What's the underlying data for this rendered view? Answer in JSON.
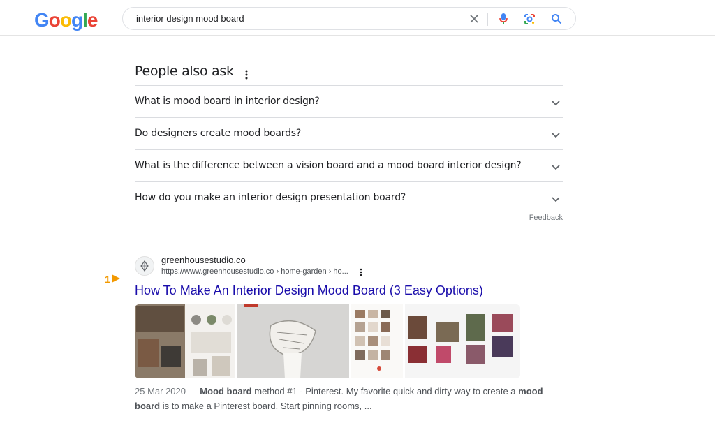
{
  "header": {
    "logo": [
      "G",
      "o",
      "o",
      "g",
      "l",
      "e"
    ],
    "logo_colors": [
      "#4285f4",
      "#ea4335",
      "#fbbc05",
      "#4285f4",
      "#34a853",
      "#ea4335"
    ],
    "query": "interior design mood board",
    "icons": {
      "clear": "close-icon",
      "mic": "mic-icon",
      "lens": "lens-icon",
      "search": "search-icon"
    }
  },
  "paa": {
    "title": "People also ask",
    "questions": [
      "What is mood board in interior design?",
      "Do designers create mood boards?",
      "What is the difference between a vision board and a mood board interior design?",
      "How do you make an interior design presentation board?"
    ],
    "feedback": "Feedback"
  },
  "result": {
    "rank": "1",
    "site_name": "greenhousestudio.co",
    "url": "https://www.greenhousestudio.co › home-garden › ho...",
    "title": "How To Make An Interior Design Mood Board (3 Easy Options)",
    "thumb1_caption": "How To Make An Interior Design Mood Board (3 Easy Options)",
    "snippet": {
      "date": "25 Mar 2020",
      "sep": " — ",
      "b1": "Mood board",
      "t1": " method #1 - Pinterest. My favorite quick and dirty way to create a ",
      "b2": "mood board",
      "t2": " is to make a Pinterest board. Start pinning rooms, ..."
    }
  },
  "colors": {
    "link": "#1a0dab",
    "rank": "#f29900"
  }
}
